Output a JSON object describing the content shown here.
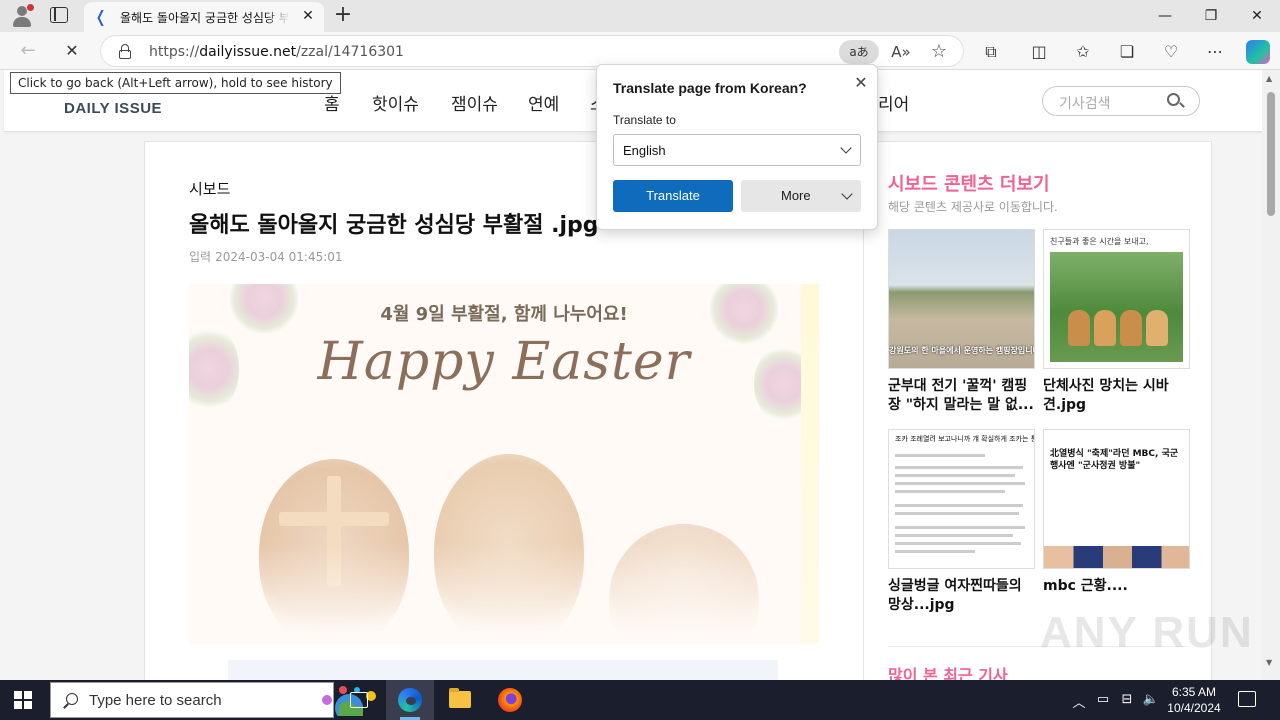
{
  "browser": {
    "tab": {
      "title": "올해도 돌아올지 궁금한 성심당 부활절",
      "close": "✕"
    },
    "new_tab": "+",
    "window": {
      "minimize": "—",
      "maximize": "❐",
      "close": "✕"
    },
    "nav": {
      "back": "←",
      "reload": "✕"
    },
    "address": {
      "scheme": "https://",
      "host": "dailyissue.net",
      "path": "/zzal/14716301"
    },
    "translate_icon": "aあ",
    "read_aloud_icon": "A»",
    "favorite_icon": "☆",
    "toolbar_icons": [
      "extensions-icon",
      "split-screen-icon",
      "favorites-icon",
      "collections-icon",
      "browser-essentials-icon",
      "more-icon",
      "copilot-icon"
    ],
    "toolbar_glyphs": {
      "extensions": "⧉",
      "split": "◫",
      "favorites": "✩",
      "collections": "❏",
      "essentials": "♡",
      "more": "⋯"
    }
  },
  "tooltip": "Click to go back (Alt+Left arrow), hold to see history",
  "site": {
    "logo": "DAILY ISSUE",
    "menu": [
      "홈",
      "핫이슈",
      "잼이슈",
      "연예",
      "스",
      "리어"
    ],
    "search_placeholder": "기사검색"
  },
  "article": {
    "category": "시보드",
    "title": "올해도 돌아올지 궁금한 성심당 부활절 .jpg",
    "date_label": "입력",
    "date": "2024-03-04 01:45:01",
    "image": {
      "subtitle": "4월 9일 부활절, 함께 나누어요!",
      "heading": "Happy Easter"
    }
  },
  "sidebar": {
    "title": "시보드 콘텐츠 더보기",
    "subtitle": "해당 콘텐츠 제공사로 이동합니다.",
    "cards": [
      {
        "caption": "군부대 전기 '꿀꺽' 캠핑장 \"하지 말라는 말 없...",
        "thumb_text": "강원도의 한 마을에서 운영하는 캠핑장입니다."
      },
      {
        "caption": "단체사진 망치는 시바견.jpg",
        "thumb_text": "친구들과 좋은 시간을 보내고,"
      },
      {
        "caption": "싱글벙글 여자찐따들의 망상...jpg",
        "thumb_text": "조카 조례열려 보고나니까 걔 확실하게 조카는 통일인 어"
      },
      {
        "caption": "mbc 근황....",
        "thumb_text": "北열병식 \"축제\"라던 MBC, 국군행사엔 \"군사정권 방불\""
      }
    ],
    "more_title": "많이 본 최근 기사"
  },
  "watermark": "ANY RUN",
  "translate_popup": {
    "title": "Translate page from Korean?",
    "close": "✕",
    "label": "Translate to",
    "selected_language": "English",
    "translate_button": "Translate",
    "more_button": "More"
  },
  "taskbar": {
    "search_placeholder": "Type here to search",
    "time": "6:35 AM",
    "date": "10/4/2024",
    "tray_glyphs": {
      "chevron": "︿",
      "network": "⊟",
      "volume": "🔈"
    }
  },
  "colors": {
    "accent": "#0f6cbd",
    "sidebar_title": "#f06292",
    "taskbar": "#1b1e2d"
  }
}
